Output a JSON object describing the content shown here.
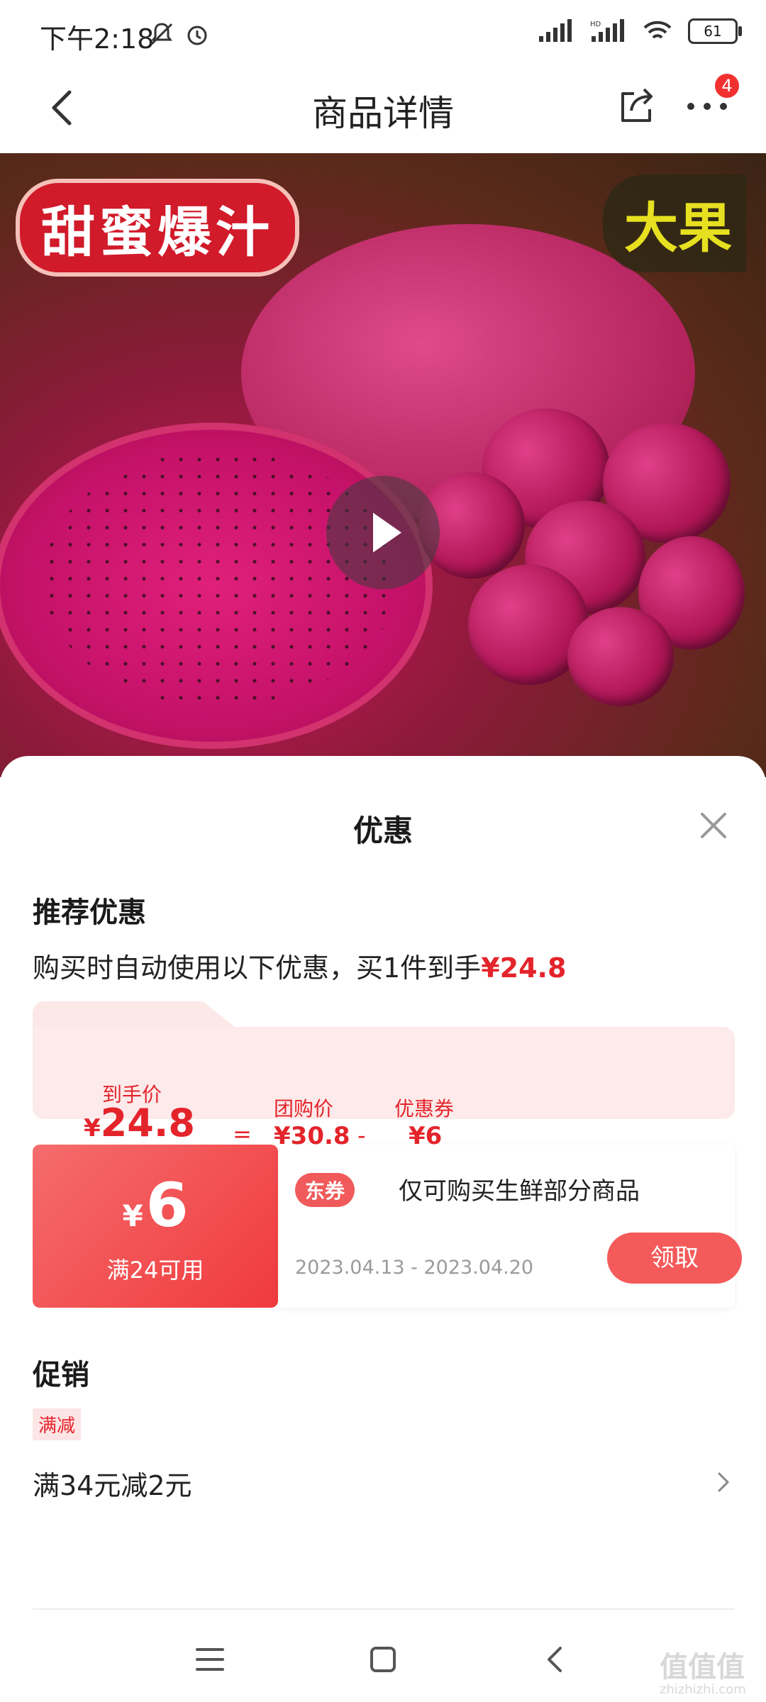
{
  "status_bar": {
    "time": "下午2:18",
    "battery": "61"
  },
  "nav": {
    "title": "商品详情",
    "badge_count": "4"
  },
  "hero": {
    "label_left": "甜蜜爆汁",
    "label_right": "大果"
  },
  "sheet": {
    "title": "优惠",
    "recommend": {
      "title": "推荐优惠",
      "desc_prefix": "购买时自动使用以下优惠，买1件到手",
      "desc_price": "¥24.8"
    },
    "price_breakdown": {
      "final_label": "到手价",
      "final_currency": "¥",
      "final_value": "24.8",
      "equals": "=",
      "group_label": "团购价",
      "group_value": "¥30.8",
      "minus": "-",
      "coupon_label": "优惠券",
      "coupon_value": "¥6"
    },
    "coupon": {
      "currency": "¥",
      "amount": "6",
      "condition": "满24可用",
      "tag": "东券",
      "desc": "仅可购买生鲜部分商品",
      "date": "2023.04.13 - 2023.04.20",
      "claim_label": "领取"
    },
    "promotion": {
      "title": "促销",
      "tag": "满减",
      "text": "满34元减2元"
    }
  },
  "watermark": {
    "main": "值值值",
    "sub": "zhizhizhi.com"
  },
  "colors": {
    "accent": "#e4242b",
    "coupon": "#f03a3e",
    "tag_bg": "#fde5e5"
  }
}
